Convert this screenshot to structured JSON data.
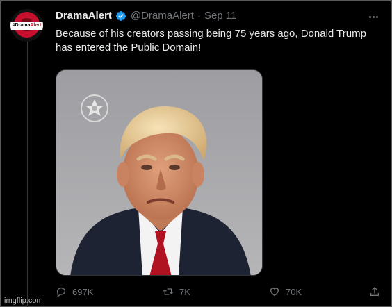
{
  "tweet": {
    "author_name": "DramaAlert",
    "handle": "@DramaAlert",
    "separator": "·",
    "date": "Sep 11",
    "text": "Because of his creators passing being 75 years ago, Donald Trump has entered the Public Domain!",
    "avatar_badge_prefix": "#Drama",
    "avatar_badge_suffix": "Alert"
  },
  "actions": {
    "replies": "697K",
    "retweets": "7K",
    "likes": "70K"
  },
  "watermark": "imgflip.com",
  "colors": {
    "background": "#000000",
    "text": "#e7e9ea",
    "muted": "#71767b",
    "verified": "#1d9bf0",
    "brand_red": "#c8102e"
  },
  "icons": [
    "verified-badge-icon",
    "more-options-icon",
    "reply-icon",
    "retweet-icon",
    "like-icon",
    "share-icon"
  ]
}
